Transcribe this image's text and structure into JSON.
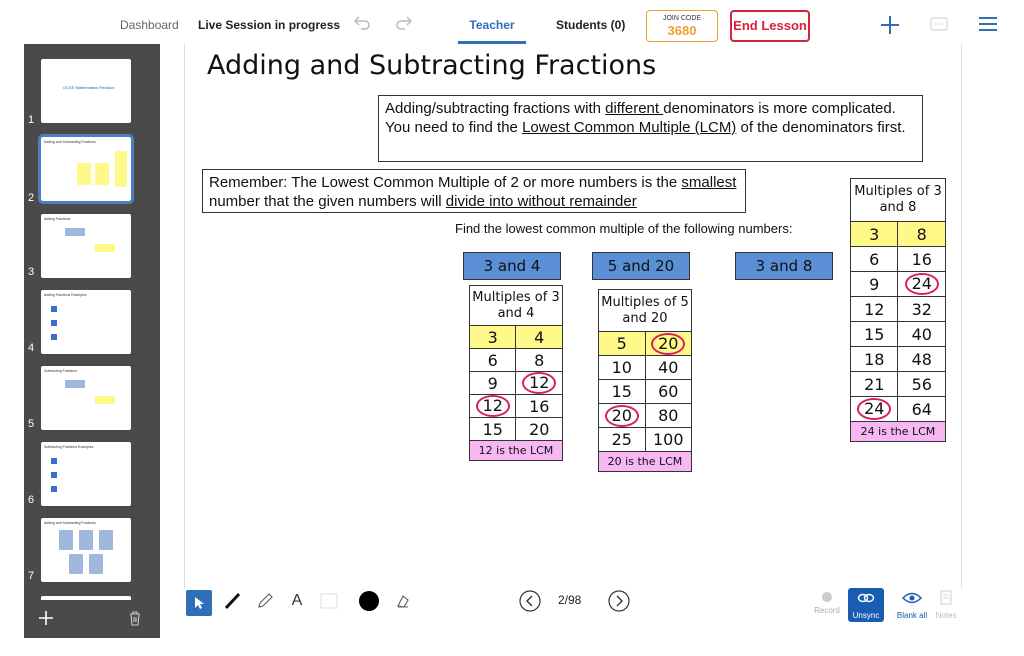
{
  "topbar": {
    "dashboard": "Dashboard",
    "session": "Live Session in progress",
    "tab_teacher": "Teacher",
    "tab_students": "Students (0)",
    "join_label": "JOIN CODE",
    "join_code": "3680",
    "end_lesson": "End Lesson"
  },
  "sidebar": {
    "thumbs": [
      {
        "num": "1",
        "title": "GCSE Mathematics Revision"
      },
      {
        "num": "2",
        "title": "Adding and Subtracting Fractions"
      },
      {
        "num": "3",
        "title": "Adding Fractions"
      },
      {
        "num": "4",
        "title": "Adding Fractions Examples"
      },
      {
        "num": "5",
        "title": "Subtracting Fractions"
      },
      {
        "num": "6",
        "title": "Subtracting Fractions Examples"
      },
      {
        "num": "7",
        "title": "Adding and Subtracting Fractions"
      }
    ]
  },
  "slide": {
    "title": "Adding and Subtracting Fractions",
    "intro_a": "Adding/subtracting fractions with ",
    "intro_u1": "different ",
    "intro_b": "denominators is more complicated. You need to find the ",
    "intro_u2": "Lowest Common Multiple (LCM)",
    "intro_c": " of the denominators first.",
    "remember_a": "Remember: The Lowest Common Multiple of 2 or more numbers is the ",
    "remember_u1": "smallest ",
    "remember_b": "number that the given numbers will ",
    "remember_u2": "divide into without remainder",
    "prompt": "Find the lowest common multiple of the following numbers:",
    "btn1": "3 and 4",
    "btn2": "5 and 20",
    "btn3": "3 and 8",
    "t1": {
      "header": "Multiples of 3 and 4",
      "rows": [
        [
          "3",
          "4"
        ],
        [
          "6",
          "8"
        ],
        [
          "9",
          "12"
        ],
        [
          "12",
          "16"
        ],
        [
          "15",
          "20"
        ]
      ],
      "footer": "12 is the LCM"
    },
    "t2": {
      "header": "Multiples of 5 and 20",
      "rows": [
        [
          "5",
          "20"
        ],
        [
          "10",
          "40"
        ],
        [
          "15",
          "60"
        ],
        [
          "20",
          "80"
        ],
        [
          "25",
          "100"
        ]
      ],
      "footer": "20 is the LCM"
    },
    "t3": {
      "header": "Multiples of 3 and 8",
      "rows": [
        [
          "3",
          "8"
        ],
        [
          "6",
          "16"
        ],
        [
          "9",
          "24"
        ],
        [
          "12",
          "32"
        ],
        [
          "15",
          "40"
        ],
        [
          "18",
          "48"
        ],
        [
          "21",
          "56"
        ],
        [
          "24",
          "64"
        ]
      ],
      "footer": "24 is the LCM"
    }
  },
  "toolbar": {
    "text_tool": "A",
    "page": "2/98",
    "record": "Record",
    "unsync": "Unsync",
    "blank_all": "Blank all",
    "notes": "Notes"
  },
  "colors": {
    "accent": "#4a7fc1",
    "end_lesson": "#d9213a",
    "join_code": "#f0a030",
    "sync_active": "#1a5cb0"
  }
}
